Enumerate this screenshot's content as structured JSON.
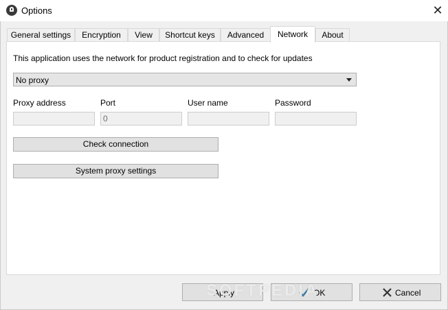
{
  "window": {
    "title": "Options",
    "close_glyph": "✕"
  },
  "tabs": [
    {
      "label": "General settings"
    },
    {
      "label": "Encryption"
    },
    {
      "label": "View"
    },
    {
      "label": "Shortcut keys"
    },
    {
      "label": "Advanced"
    },
    {
      "label": "Network",
      "active": true
    },
    {
      "label": "About"
    }
  ],
  "network": {
    "description": "This application uses the network for product registration and to check for updates",
    "proxy_select": {
      "selected": "No proxy"
    },
    "fields": {
      "proxy_address": {
        "label": "Proxy address",
        "value": ""
      },
      "port": {
        "label": "Port",
        "value": "0"
      },
      "user_name": {
        "label": "User name",
        "value": ""
      },
      "password": {
        "label": "Password",
        "value": ""
      }
    },
    "check_connection_label": "Check connection",
    "system_proxy_label": "System proxy settings"
  },
  "footer": {
    "apply_label": "Apply",
    "ok_label": "OK",
    "cancel_label": "Cancel",
    "ok_icon": "checkmark-icon",
    "cancel_icon": "close-icon",
    "watermark": "SOFTPEDIA"
  }
}
